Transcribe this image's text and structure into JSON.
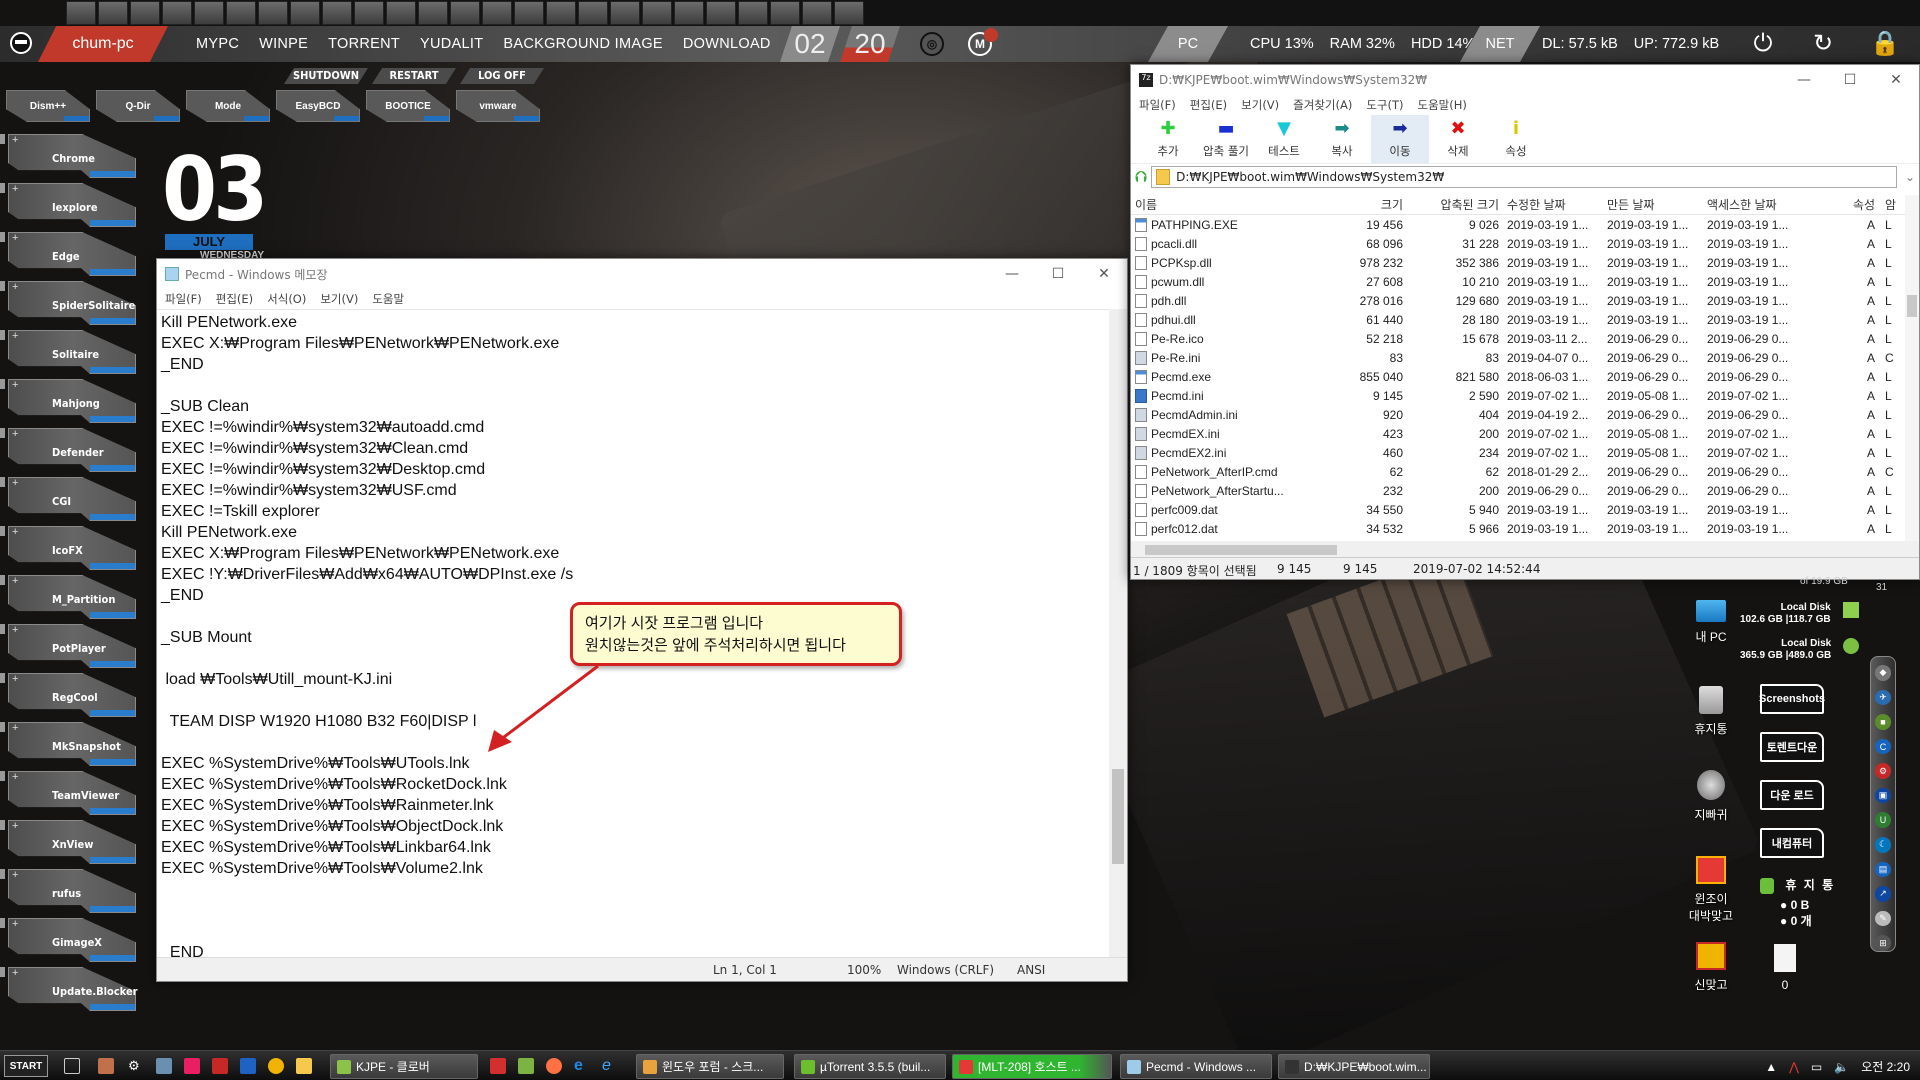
{
  "quick_launch": [
    "chrome",
    "app-blue",
    "ie",
    "clover",
    "lock-tool",
    "installer",
    "browser-orb",
    "triangle-tool",
    "acrobat",
    "drop",
    "rename-tool",
    "vbox",
    "uTools",
    "utorrent",
    "idm",
    "7zip",
    "settings",
    "feather",
    "cards",
    "notepad-paper",
    "photo",
    "ring-app",
    "A-app",
    "printer",
    "windows-logo"
  ],
  "topbar": {
    "hostname": "chum-pc",
    "nav": [
      "MYPC",
      "WINPE",
      "TORRENT",
      "YUDALIT",
      "BACKGROUND IMAGE",
      "DOWNLOAD"
    ],
    "clock_hour": "02",
    "clock_minute": "20",
    "pc_label": "PC",
    "cpu": "CPU  13%",
    "ram": "RAM  32%",
    "hdd": "HDD  14%",
    "net_label": "NET",
    "dl": "DL:  57.5 kB",
    "up": "UP:  772.9 kB"
  },
  "power_buttons": [
    "SHUTDOWN",
    "RESTART",
    "LOG OFF"
  ],
  "tool_tiles": [
    "Dism++",
    "Q-Dir",
    "Mode",
    "EasyBCD",
    "BOOTICE",
    "vmware"
  ],
  "dock": [
    "Chrome",
    "Iexplore",
    "Edge",
    "SpiderSolitaire",
    "Solitaire",
    "Mahjong",
    "Defender",
    "CGI",
    "IcoFX",
    "M_Partition",
    "PotPlayer",
    "RegCool",
    "MkSnapshot",
    "TeamViewer",
    "XnView",
    "rufus",
    "GimageX",
    "Update.Blocker"
  ],
  "date": {
    "day": "03",
    "month": "JULY",
    "weekday": "WEDNESDAY"
  },
  "notepad": {
    "title": "Pecmd - Windows 메모장",
    "menu": [
      "파일(F)",
      "편집(E)",
      "서식(O)",
      "보기(V)",
      "도움말"
    ],
    "text": "Kill PENetwork.exe\nEXEC X:₩Program Files₩PENetwork₩PENetwork.exe\n_END\n\n_SUB Clean\nEXEC !=%windir%₩system32₩autoadd.cmd\nEXEC !=%windir%₩system32₩Clean.cmd\nEXEC !=%windir%₩system32₩Desktop.cmd\nEXEC !=%windir%₩system32₩USF.cmd\nEXEC !=Tskill explorer\nKill PENetwork.exe\nEXEC X:₩Program Files₩PENetwork₩PENetwork.exe\nEXEC !Y:₩DriverFiles₩Add₩x64₩AUTO₩DPInst.exe /s\n_END\n\n_SUB Mount\n\n load ₩Tools₩Utill_mount-KJ.ini\n\n  TEAM DISP W1920 H1080 B32 F60|DISP l\n\nEXEC %SystemDrive%₩Tools₩UTools.lnk\nEXEC %SystemDrive%₩Tools₩RocketDock.lnk\nEXEC %SystemDrive%₩Tools₩Rainmeter.lnk\nEXEC %SystemDrive%₩Tools₩ObjectDock.lnk\nEXEC %SystemDrive%₩Tools₩Linkbar64.lnk\nEXEC %SystemDrive%₩Tools₩Volume2.lnk\n\n\n\n_END",
    "status": {
      "position": "Ln 1, Col 1",
      "zoom": "100%",
      "eol": "Windows (CRLF)",
      "encoding": "ANSI"
    }
  },
  "callout": {
    "line1": "여기가 시잣 프로그램 입니다",
    "line2": "원치않는것은 앞에 주석처리하시면 됩니다"
  },
  "sevenzip": {
    "title": "D:₩KJPE₩boot.wim₩Windows₩System32₩",
    "menu": [
      "파일(F)",
      "편집(E)",
      "보기(V)",
      "즐겨찾기(A)",
      "도구(T)",
      "도움말(H)"
    ],
    "toolbar": [
      {
        "label": "추가",
        "icon": "add-icon",
        "glyph": "✚",
        "color": "#2ecc40"
      },
      {
        "label": "압축 풀기",
        "icon": "extract-icon",
        "glyph": "▬",
        "color": "#1a2fd6"
      },
      {
        "label": "테스트",
        "icon": "test-icon",
        "glyph": "▼",
        "color": "#17c8d8"
      },
      {
        "label": "복사",
        "icon": "copy-icon",
        "glyph": "➡",
        "color": "#1a8a8a"
      },
      {
        "label": "이동",
        "icon": "move-icon",
        "glyph": "➡",
        "color": "#1a2a9a"
      },
      {
        "label": "삭제",
        "icon": "delete-icon",
        "glyph": "✖",
        "color": "#e01010"
      },
      {
        "label": "속성",
        "icon": "info-icon",
        "glyph": "i",
        "color": "#d8c800"
      }
    ],
    "address": "D:₩KJPE₩boot.wim₩Windows₩System32₩",
    "columns": [
      "이름",
      "크기",
      "압축된 크기",
      "수정한 날짜",
      "만든 날짜",
      "액세스한 날짜",
      "속성",
      "암"
    ],
    "rows": [
      {
        "type": "exe",
        "name": "PATHPING.EXE",
        "size": "19 456",
        "packed": "9 026",
        "modified": "2019-03-19 1...",
        "created": "2019-03-19 1...",
        "accessed": "2019-03-19 1...",
        "attr": "A",
        "x": "L"
      },
      {
        "type": "dll",
        "name": "pcacli.dll",
        "size": "68 096",
        "packed": "31 228",
        "modified": "2019-03-19 1...",
        "created": "2019-03-19 1...",
        "accessed": "2019-03-19 1...",
        "attr": "A",
        "x": "L"
      },
      {
        "type": "dll",
        "name": "PCPKsp.dll",
        "size": "978 232",
        "packed": "352 386",
        "modified": "2019-03-19 1...",
        "created": "2019-03-19 1...",
        "accessed": "2019-03-19 1...",
        "attr": "A",
        "x": "L"
      },
      {
        "type": "dll",
        "name": "pcwum.dll",
        "size": "27 608",
        "packed": "10 210",
        "modified": "2019-03-19 1...",
        "created": "2019-03-19 1...",
        "accessed": "2019-03-19 1...",
        "attr": "A",
        "x": "L"
      },
      {
        "type": "dll",
        "name": "pdh.dll",
        "size": "278 016",
        "packed": "129 680",
        "modified": "2019-03-19 1...",
        "created": "2019-03-19 1...",
        "accessed": "2019-03-19 1...",
        "attr": "A",
        "x": "L"
      },
      {
        "type": "dll",
        "name": "pdhui.dll",
        "size": "61 440",
        "packed": "28 180",
        "modified": "2019-03-19 1...",
        "created": "2019-03-19 1...",
        "accessed": "2019-03-19 1...",
        "attr": "A",
        "x": "L"
      },
      {
        "type": "file",
        "name": "Pe-Re.ico",
        "size": "52 218",
        "packed": "15 678",
        "modified": "2019-03-11 2...",
        "created": "2019-06-29 0...",
        "accessed": "2019-06-29 0...",
        "attr": "A",
        "x": "L"
      },
      {
        "type": "ini",
        "name": "Pe-Re.ini",
        "size": "83",
        "packed": "83",
        "modified": "2019-04-07 0...",
        "created": "2019-06-29 0...",
        "accessed": "2019-06-29 0...",
        "attr": "A",
        "x": "C"
      },
      {
        "type": "exe",
        "name": "Pecmd.exe",
        "size": "855 040",
        "packed": "821 580",
        "modified": "2018-06-03 1...",
        "created": "2019-06-29 0...",
        "accessed": "2019-06-29 0...",
        "attr": "A",
        "x": "L"
      },
      {
        "type": "sel",
        "name": "Pecmd.ini",
        "size": "9 145",
        "packed": "2 590",
        "modified": "2019-07-02 1...",
        "created": "2019-05-08 1...",
        "accessed": "2019-07-02 1...",
        "attr": "A",
        "x": "L"
      },
      {
        "type": "ini",
        "name": "PecmdAdmin.ini",
        "size": "920",
        "packed": "404",
        "modified": "2019-04-19 2...",
        "created": "2019-06-29 0...",
        "accessed": "2019-06-29 0...",
        "attr": "A",
        "x": "L"
      },
      {
        "type": "ini",
        "name": "PecmdEX.ini",
        "size": "423",
        "packed": "200",
        "modified": "2019-07-02 1...",
        "created": "2019-05-08 1...",
        "accessed": "2019-07-02 1...",
        "attr": "A",
        "x": "L"
      },
      {
        "type": "ini",
        "name": "PecmdEX2.ini",
        "size": "460",
        "packed": "234",
        "modified": "2019-07-02 1...",
        "created": "2019-05-08 1...",
        "accessed": "2019-07-02 1...",
        "attr": "A",
        "x": "L"
      },
      {
        "type": "dll",
        "name": "PeNetwork_AfterIP.cmd",
        "size": "62",
        "packed": "62",
        "modified": "2018-01-29 2...",
        "created": "2019-06-29 0...",
        "accessed": "2019-06-29 0...",
        "attr": "A",
        "x": "C"
      },
      {
        "type": "dll",
        "name": "PeNetwork_AfterStartu...",
        "size": "232",
        "packed": "200",
        "modified": "2019-06-29 0...",
        "created": "2019-06-29 0...",
        "accessed": "2019-06-29 0...",
        "attr": "A",
        "x": "L"
      },
      {
        "type": "file",
        "name": "perfc009.dat",
        "size": "34 550",
        "packed": "5 940",
        "modified": "2019-03-19 1...",
        "created": "2019-03-19 1...",
        "accessed": "2019-03-19 1...",
        "attr": "A",
        "x": "L"
      },
      {
        "type": "file",
        "name": "perfc012.dat",
        "size": "34 532",
        "packed": "5 966",
        "modified": "2019-03-19 1...",
        "created": "2019-03-19 1...",
        "accessed": "2019-03-19 1...",
        "attr": "A",
        "x": "L"
      }
    ],
    "status": {
      "selected": "1 / 1809 항목이 선택됨",
      "size": "9 145",
      "packed": "9 145",
      "modified": "2019-07-02 14:52:44"
    }
  },
  "desktop": {
    "icons": {
      "mypc": "내 PC",
      "recycle": "휴지통",
      "jibbagwi": "지빠귀",
      "gostop1_l1": "윈조이",
      "gostop1_l2": "대박맞고",
      "gostop2": "신맞고",
      "note_count": "0"
    },
    "disks": [
      {
        "label": "Local Disk",
        "free": "102.6 GB",
        "total": "|118.7 GB"
      },
      {
        "label": "Local Disk",
        "free": "365.9 GB",
        "total": "|489.0 GB"
      }
    ],
    "disk_top_text": "of 19.9 GB",
    "corner_num": "31",
    "folders": [
      "Screenshots",
      "토렌트다운",
      "다운 로드",
      "내컴퓨터"
    ],
    "recycle_widget": {
      "title": "휴 지 통",
      "size": "0 B",
      "count": "0 개"
    }
  },
  "taskbar": {
    "start": "START",
    "tasks": [
      {
        "label": "KJPE - 클로버",
        "color": "#8bc34a"
      },
      {
        "label": "윈도우 포럼 - 스크...",
        "color": "#e8a33c"
      },
      {
        "label": "µTorrent 3.5.5  (buil...",
        "color": "#6bbf2e"
      },
      {
        "label": "[MLT-208] 호스트 ...",
        "color": "#e53935",
        "active": true
      },
      {
        "label": "Pecmd - Windows ...",
        "color": "#9ecbe8"
      },
      {
        "label": "D:₩KJPE₩boot.wim...",
        "color": "#333"
      }
    ],
    "clock": "오전 2:20"
  }
}
